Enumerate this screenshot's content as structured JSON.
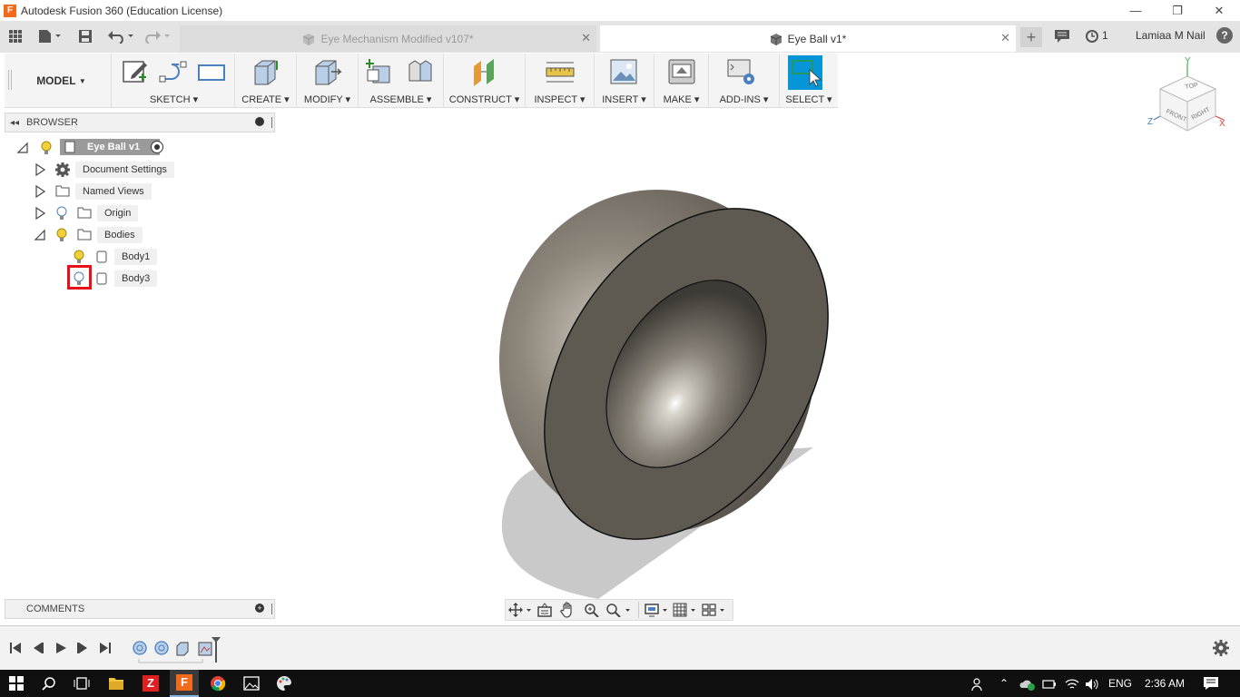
{
  "window": {
    "title": "Autodesk Fusion 360 (Education License)",
    "minimize": "—",
    "restore": "❐",
    "close": "✕"
  },
  "tabs": [
    {
      "label": "Eye Mechanism Modified v107*",
      "active": false
    },
    {
      "label": "Eye Ball v1*",
      "active": true
    }
  ],
  "header": {
    "job_count": "1",
    "user": "Lamiaa M Nail",
    "help": "?"
  },
  "toolbar": {
    "workspace": "MODEL",
    "groups": [
      {
        "label": "SKETCH"
      },
      {
        "label": "CREATE"
      },
      {
        "label": "MODIFY"
      },
      {
        "label": "ASSEMBLE"
      },
      {
        "label": "CONSTRUCT"
      },
      {
        "label": "INSPECT"
      },
      {
        "label": "INSERT"
      },
      {
        "label": "MAKE"
      },
      {
        "label": "ADD-INS"
      },
      {
        "label": "SELECT"
      }
    ]
  },
  "browser": {
    "title": "BROWSER",
    "root": "Eye Ball v1",
    "items": [
      {
        "label": "Document Settings"
      },
      {
        "label": "Named Views"
      },
      {
        "label": "Origin"
      },
      {
        "label": "Bodies"
      },
      {
        "label": "Body1"
      },
      {
        "label": "Body3"
      }
    ]
  },
  "comments": {
    "title": "COMMENTS"
  },
  "viewcube": {
    "top": "TOP",
    "front": "FRONT",
    "right": "RIGHT",
    "x": "X",
    "y": "Y",
    "z": "Z"
  },
  "taskbar": {
    "lang": "ENG",
    "time": "2:36 AM"
  },
  "colors": {
    "accent": "#0696d7",
    "highlight_box": "#e8101b",
    "body": "#5e5a52"
  }
}
